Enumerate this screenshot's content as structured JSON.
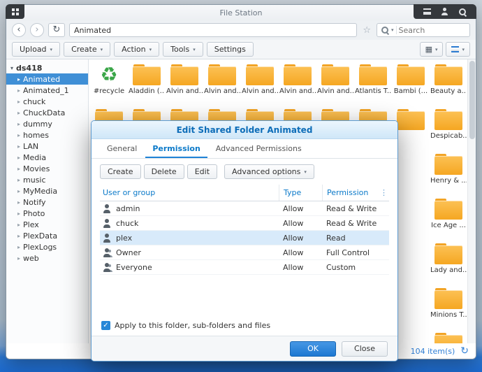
{
  "taskbar": {
    "left_icons": [
      "main-menu"
    ],
    "right_icons": [
      "menu-lines",
      "user",
      "search"
    ]
  },
  "window": {
    "title": "File Station",
    "nav": {
      "path_value": "Animated",
      "search_placeholder": "Search"
    },
    "toolbar": {
      "upload_label": "Upload",
      "create_label": "Create",
      "action_label": "Action",
      "tools_label": "Tools",
      "settings_label": "Settings"
    },
    "sidebar": {
      "root_label": "ds418",
      "selected_item": "Animated",
      "items": [
        "Animated",
        "Animated_1",
        "chuck",
        "ChuckData",
        "dummy",
        "homes",
        "LAN",
        "Media",
        "Movies",
        "music",
        "MyMedia",
        "Notify",
        "Photo",
        "Plex",
        "PlexData",
        "PlexLogs",
        "web"
      ]
    },
    "files": {
      "row1": [
        {
          "label": "#recycle",
          "kind": "recycle"
        },
        {
          "label": "Aladdin (...",
          "kind": "folder"
        },
        {
          "label": "Alvin and...",
          "kind": "folder"
        },
        {
          "label": "Alvin and...",
          "kind": "folder"
        },
        {
          "label": "Alvin and...",
          "kind": "folder"
        },
        {
          "label": "Alvin and...",
          "kind": "folder"
        },
        {
          "label": "Alvin and...",
          "kind": "folder"
        },
        {
          "label": "Atlantis T...",
          "kind": "folder"
        },
        {
          "label": "Bambi (...",
          "kind": "folder"
        },
        {
          "label": "Beauty a...",
          "kind": "folder"
        }
      ],
      "row2_visible_label": "Despicab...",
      "right_column_labels": [
        "Henry & ...",
        "Ice Age ...",
        "Lady and...",
        "Minions T..."
      ]
    },
    "status": {
      "item_count": "104 item(s)"
    }
  },
  "dialog": {
    "title": "Edit Shared Folder Animated",
    "tabs": [
      {
        "label": "General",
        "active": false
      },
      {
        "label": "Permission",
        "active": true
      },
      {
        "label": "Advanced Permissions",
        "active": false
      }
    ],
    "actions": {
      "create": "Create",
      "delete": "Delete",
      "edit": "Edit",
      "advanced": "Advanced options"
    },
    "table": {
      "headers": {
        "user": "User or group",
        "type": "Type",
        "permission": "Permission"
      },
      "rows": [
        {
          "name": "admin",
          "icon": "user",
          "type": "Allow",
          "permission": "Read & Write",
          "selected": false
        },
        {
          "name": "chuck",
          "icon": "user",
          "type": "Allow",
          "permission": "Read & Write",
          "selected": false
        },
        {
          "name": "plex",
          "icon": "user",
          "type": "Allow",
          "permission": "Read",
          "selected": true
        },
        {
          "name": "Owner",
          "icon": "user-group",
          "type": "Allow",
          "permission": "Full Control",
          "selected": false
        },
        {
          "name": "Everyone",
          "icon": "user-group",
          "type": "Allow",
          "permission": "Custom",
          "selected": false
        }
      ]
    },
    "checkbox": {
      "label": "Apply to this folder, sub-folders and files",
      "checked": true
    },
    "footer": {
      "ok_label": "OK",
      "close_label": "Close"
    }
  },
  "colors": {
    "accent_blue": "#2787d7",
    "folder_orange": "#f5a722",
    "selection_blue": "#3f8fd6",
    "link_blue": "#0c7ac9",
    "taskbar_dark": "#34383c"
  }
}
